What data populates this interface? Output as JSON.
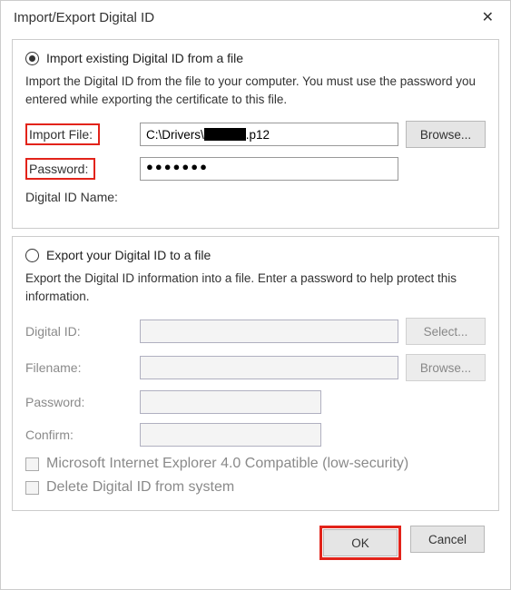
{
  "titlebar": {
    "title": "Import/Export Digital ID",
    "close_icon": "✕"
  },
  "import_section": {
    "radio_label": "Import existing Digital ID from a file",
    "description": "Import the Digital ID from the file to your computer. You must use the password you entered while exporting the certificate to this file.",
    "import_file_label": "Import File:",
    "import_file_value_prefix": "C:\\Drivers\\",
    "import_file_value_suffix": ".p12",
    "password_label": "Password:",
    "password_value": "●●●●●●●",
    "digital_id_name_label": "Digital ID Name:",
    "browse_label": "Browse..."
  },
  "export_section": {
    "radio_label": "Export your Digital ID to a file",
    "description": "Export the Digital ID information into a file. Enter a password to help protect this information.",
    "digital_id_label": "Digital ID:",
    "filename_label": "Filename:",
    "password_label": "Password:",
    "confirm_label": "Confirm:",
    "select_label": "Select...",
    "browse_label": "Browse...",
    "checkbox_ie4": "Microsoft Internet Explorer 4.0 Compatible (low-security)",
    "checkbox_delete": "Delete Digital ID from system"
  },
  "footer": {
    "ok_label": "OK",
    "cancel_label": "Cancel"
  }
}
